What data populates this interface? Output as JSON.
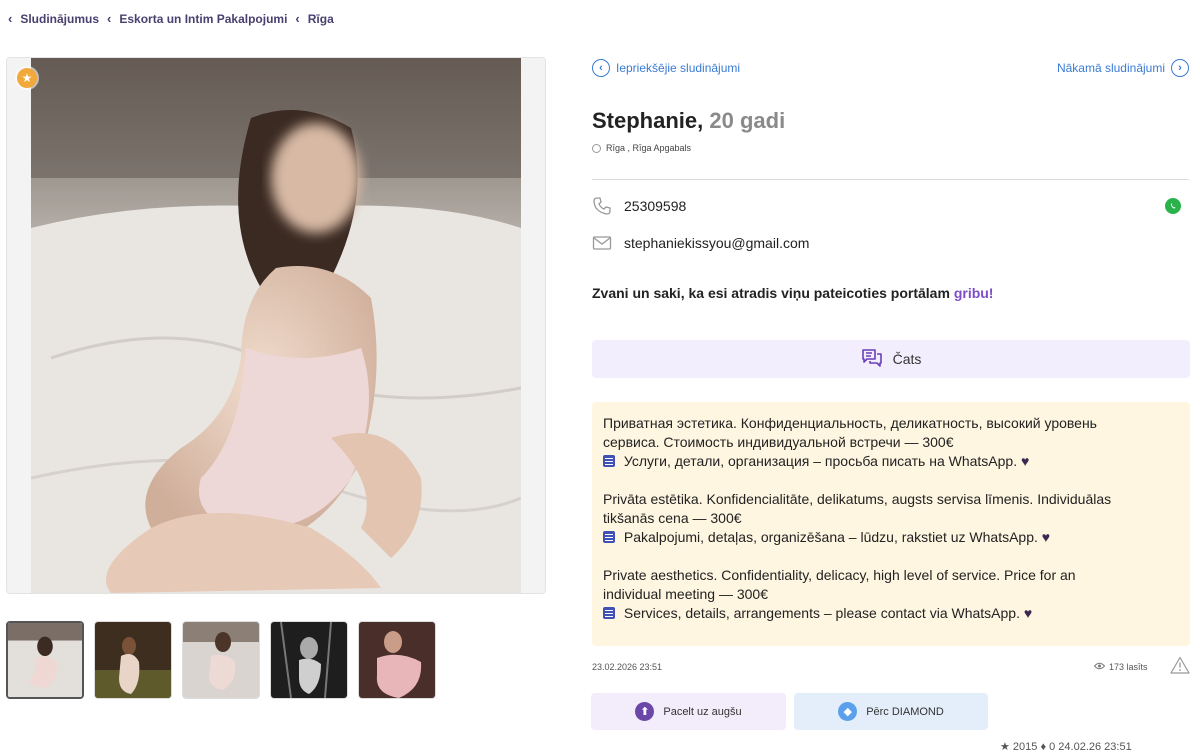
{
  "breadcrumb": {
    "items": [
      {
        "label": "Sludinājumus"
      },
      {
        "label": "Eskorta un Intim Pakalpojumi"
      },
      {
        "label": "Rīga"
      }
    ]
  },
  "nav": {
    "prev_label": "Iepriekšējie sludinājumi",
    "next_label": "Nākamā sludinājumi"
  },
  "listing": {
    "name": "Stephanie,",
    "age": "20 gadi",
    "location": "Rīga ,  Rīga Apgabals",
    "phone": "25309598",
    "email": "stephaniekissyou@gmail.com",
    "call_note_text": "Zvani un saki, ka esi atradis viņu pateicoties portālam ",
    "call_note_brand": "gribu!"
  },
  "chat": {
    "label": "Čats"
  },
  "description": {
    "ru_line1": "Приватная эстетика. Конфиденциальность, деликатность, высокий уровень",
    "ru_line2": "сервиса. Стоимость индивидуальной встречи — 300€",
    "ru_line3": " Услуги, детали, организация – просьба писать на WhatsApp. ",
    "lv_line1": "Privāta estētika. Konfidencialitāte, delikatums, augsts servisa līmenis. Individuālas",
    "lv_line2": "tikšanās cena — 300€",
    "lv_line3": " Pakalpojumi, detaļas, organizēšana – lūdzu, rakstiet uz WhatsApp. ",
    "en_line1": "Private aesthetics. Confidentiality, delicacy, high level of service. Price for an",
    "en_line2": "individual meeting — 300€",
    "en_line3": " Services, details, arrangements – please contact via WhatsApp. ",
    "heart": "♥"
  },
  "meta": {
    "date": "23.02.2026 23:51",
    "views": "173 lasīts"
  },
  "actions": {
    "raise_label": "Pacelt uz augšu",
    "diamond_label": "Pērc DIAMOND"
  },
  "footer_cutoff": "★ 2015  ♦  0 24.02.26 23:51",
  "icons": {
    "star": "star-icon",
    "phone": "phone-icon",
    "email": "mail-icon",
    "whatsapp": "whatsapp-icon",
    "chat": "chat-icon",
    "eye": "eye-icon",
    "warning": "warning-icon",
    "arrow_up": "arrow-up-icon",
    "diamond": "diamond-icon"
  },
  "colors": {
    "accent_blue": "#3a7bd5",
    "brand_purple": "#7d4cc8",
    "star_orange": "#f2a93b",
    "whatsapp_green": "#2bb34b",
    "desc_bg": "#fff6e1",
    "chat_bg": "#f3eefd"
  }
}
